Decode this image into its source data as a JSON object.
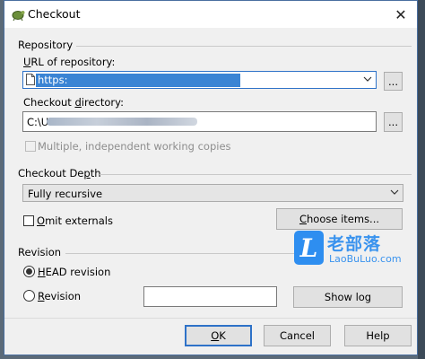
{
  "window": {
    "title": "Checkout",
    "close_glyph": "✕"
  },
  "repository_group": {
    "label": "Repository",
    "url_label_prefix": "",
    "url_label_u": "U",
    "url_label_rest": "RL of repository:",
    "url_value": "https:",
    "browse_label": "...",
    "dir_label_prefix": "Checkout ",
    "dir_label_u": "d",
    "dir_label_rest": "irectory:",
    "dir_value": "C:\\U",
    "dir_browse_label": "...",
    "multiple_label": "Multiple, independent working copies"
  },
  "depth_group": {
    "label_prefix": "Checkout De",
    "label_u": "p",
    "label_rest": "th",
    "depth_value": "Fully recursive",
    "omit_prefix": "",
    "omit_u": "O",
    "omit_rest": "mit externals",
    "choose_prefix": "",
    "choose_u": "C",
    "choose_rest": "hoose items..."
  },
  "revision_group": {
    "label": "Revision",
    "head_prefix": "",
    "head_u": "H",
    "head_rest": "EAD revision",
    "rev_prefix": "",
    "rev_u": "R",
    "rev_rest": "evision",
    "show_log_label": "Show log"
  },
  "buttons": {
    "ok_u": "O",
    "ok_rest": "K",
    "cancel": "Cancel",
    "help": "Help"
  },
  "watermark": {
    "glyph": "L",
    "cn": "老部落",
    "en": "LaoBuLuo.com"
  },
  "colors": {
    "accent": "#2e72c8",
    "selection": "#3a84d4",
    "watermark": "#3a93ee"
  }
}
